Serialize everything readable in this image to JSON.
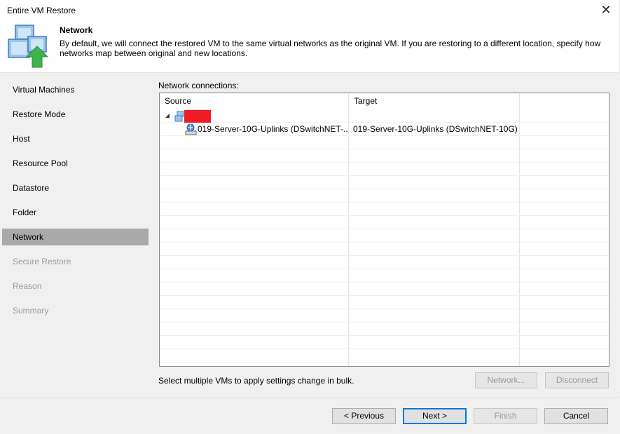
{
  "window": {
    "title": "Entire VM Restore"
  },
  "header": {
    "title": "Network",
    "description": "By default, we will connect the restored VM to the same virtual networks as the original VM. If you are restoring to a different location, specify how networks map between original and new locations."
  },
  "sidebar": {
    "items": [
      {
        "label": "Virtual Machines",
        "state": "normal"
      },
      {
        "label": "Restore Mode",
        "state": "normal"
      },
      {
        "label": "Host",
        "state": "normal"
      },
      {
        "label": "Resource Pool",
        "state": "normal"
      },
      {
        "label": "Datastore",
        "state": "normal"
      },
      {
        "label": "Folder",
        "state": "normal"
      },
      {
        "label": "Network",
        "state": "active"
      },
      {
        "label": "Secure Restore",
        "state": "disabled"
      },
      {
        "label": "Reason",
        "state": "disabled"
      },
      {
        "label": "Summary",
        "state": "disabled"
      }
    ]
  },
  "main": {
    "section_label": "Network connections:",
    "columns": {
      "source": "Source",
      "target": "Target"
    },
    "rows": [
      {
        "source": "019-Server-10G-Uplinks (DSwitchNET-...",
        "target": "019-Server-10G-Uplinks (DSwitchNET-10G)"
      }
    ],
    "bulk_note": "Select multiple VMs to apply settings change in bulk.",
    "network_button": "Network...",
    "disconnect_button": "Disconnect"
  },
  "footer": {
    "previous": "< Previous",
    "next": "Next >",
    "finish": "Finish",
    "cancel": "Cancel"
  },
  "colors": {
    "redacted": "#ee1c24",
    "active_step": "#a9a9a9",
    "accent": "#0078d7"
  }
}
